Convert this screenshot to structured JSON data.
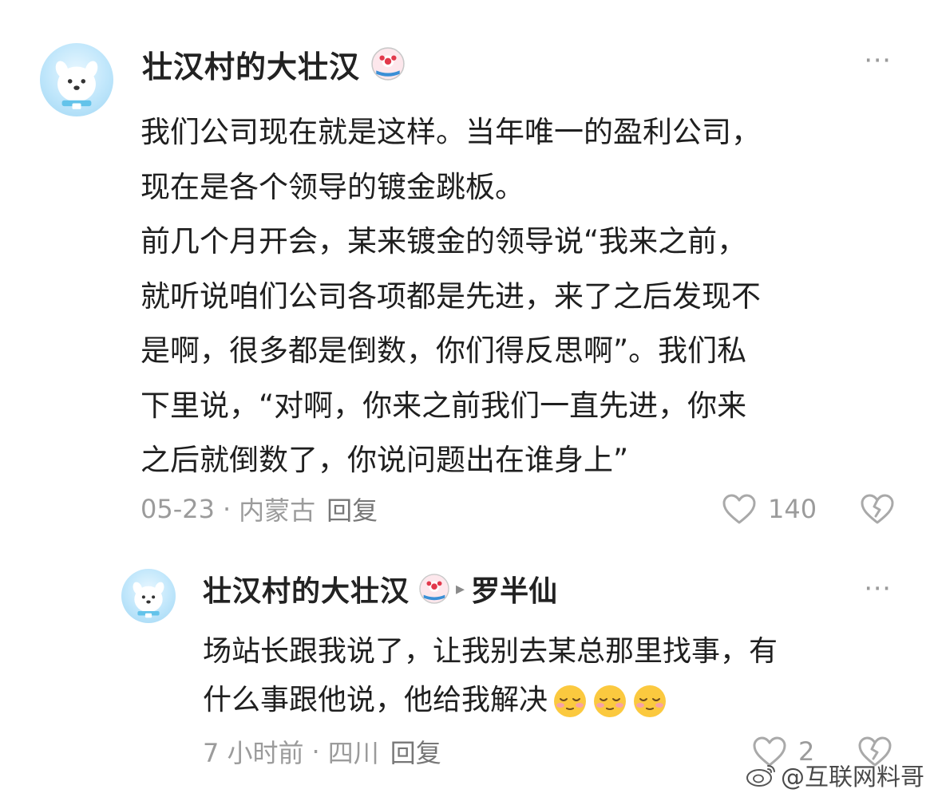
{
  "comment1": {
    "username": "壮汉村的大壮汉",
    "lines": [
      "我们公司现在就是这样。当年唯一的盈利公司，",
      "现在是各个领导的镀金跳板。",
      "前几个月开会，某来镀金的领导说“我来之前，",
      "就听说咱们公司各项都是先进，来了之后发现不",
      "是啊，很多都是倒数，你们得反思啊”。我们私",
      "下里说，“对啊，你来之前我们一直先进，你来",
      "之后就倒数了，你说问题出在谁身上”"
    ],
    "date": "05-23",
    "location": "内蒙古",
    "reply_label": "回复",
    "like_count": "140",
    "more_icon": "more-dots-icon"
  },
  "comment2": {
    "username": "壮汉村的大壮汉",
    "reply_to": "罗半仙",
    "lines": [
      "场站长跟我说了，让我别去某总那里找事，有",
      "什么事跟他说，他给我解决"
    ],
    "emoji_count": 3,
    "date": "7 小时前",
    "location": "四川",
    "reply_label": "回复",
    "like_count": "2"
  },
  "meta_separator": "·",
  "reply_arrow": "▸",
  "watermark": "@互联网料哥",
  "colors": {
    "text": "#1f1f1f",
    "meta": "#9b9b9b",
    "avatar_bg": "#bfe6fb"
  }
}
